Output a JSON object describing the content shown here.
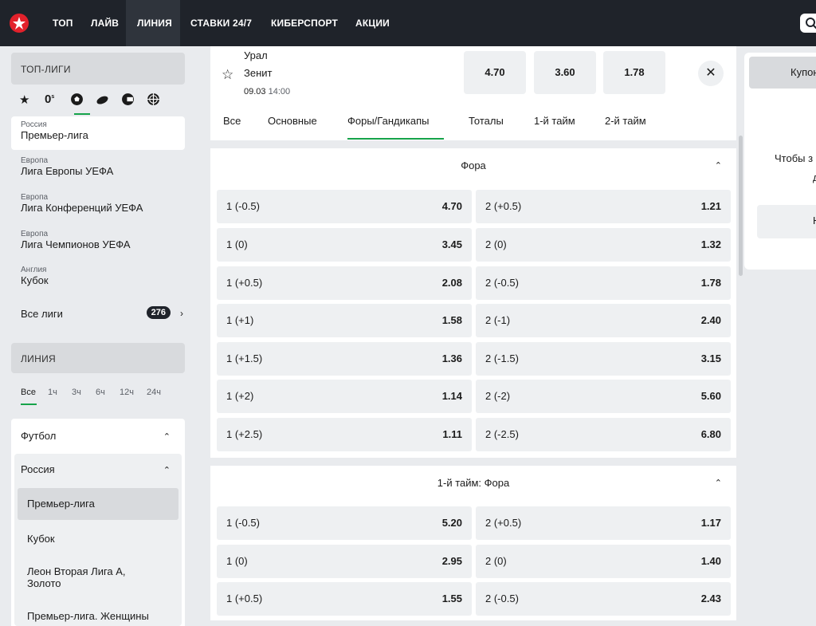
{
  "nav": {
    "items": [
      "ТОП",
      "ЛАЙВ",
      "ЛИНИЯ",
      "СТАВКИ 24/7",
      "КИБЕРСПОРТ",
      "АКЦИИ"
    ],
    "active": "ЛИНИЯ"
  },
  "sidebar": {
    "top_leagues_title": "ТОП-ЛИГИ",
    "sport_icons": [
      "star-icon",
      "zero-icon",
      "soccer-ball-icon",
      "hockey-puck-icon",
      "esports-icon",
      "basketball-icon"
    ],
    "zero_label": "0",
    "zero_sup": "s",
    "leagues": [
      {
        "country": "Россия",
        "name": "Премьер-лига"
      },
      {
        "country": "Европа",
        "name": "Лига Европы УЕФА"
      },
      {
        "country": "Европа",
        "name": "Лига Конференций УЕФА"
      },
      {
        "country": "Европа",
        "name": "Лига Чемпионов УЕФА"
      },
      {
        "country": "Англия",
        "name": "Кубок"
      }
    ],
    "all_leagues_label": "Все лиги",
    "all_leagues_count": "276",
    "line_title": "ЛИНИЯ",
    "time_filters": [
      "Все",
      "1ч",
      "3ч",
      "6ч",
      "12ч",
      "24ч"
    ],
    "sport": "Футбол",
    "country": "Россия",
    "sub_leagues": [
      "Премьер-лига",
      "Кубок",
      "Леон Вторая Лига А, Золото",
      "Премьер-лига. Женщины"
    ]
  },
  "match": {
    "team1": "Урал",
    "team2": "Зенит",
    "date": "09.03",
    "time": "14:00",
    "odds": [
      "4.70",
      "3.60",
      "1.78"
    ],
    "close": "✕",
    "tabs": [
      "Все",
      "Основные",
      "Форы/Гандикапы",
      "Тоталы",
      "1-й тайм",
      "2-й тайм"
    ],
    "active_tab": "Форы/Гандикапы"
  },
  "markets": [
    {
      "title": "Фора",
      "rows": [
        {
          "l1": "1 (-0.5)",
          "v1": "4.70",
          "l2": "2 (+0.5)",
          "v2": "1.21"
        },
        {
          "l1": "1 (0)",
          "v1": "3.45",
          "l2": "2 (0)",
          "v2": "1.32"
        },
        {
          "l1": "1 (+0.5)",
          "v1": "2.08",
          "l2": "2 (-0.5)",
          "v2": "1.78"
        },
        {
          "l1": "1 (+1)",
          "v1": "1.58",
          "l2": "2 (-1)",
          "v2": "2.40"
        },
        {
          "l1": "1 (+1.5)",
          "v1": "1.36",
          "l2": "2 (-1.5)",
          "v2": "3.15"
        },
        {
          "l1": "1 (+2)",
          "v1": "1.14",
          "l2": "2 (-2)",
          "v2": "5.60"
        },
        {
          "l1": "1 (+2.5)",
          "v1": "1.11",
          "l2": "2 (-2.5)",
          "v2": "6.80"
        }
      ]
    },
    {
      "title": "1-й тайм: Фора",
      "rows": [
        {
          "l1": "1 (-0.5)",
          "v1": "5.20",
          "l2": "2 (+0.5)",
          "v2": "1.17"
        },
        {
          "l1": "1 (0)",
          "v1": "2.95",
          "l2": "2 (0)",
          "v2": "1.40"
        },
        {
          "l1": "1 (+0.5)",
          "v1": "1.55",
          "l2": "2 (-0.5)",
          "v2": "2.43"
        }
      ]
    }
  ],
  "coupon": {
    "tab_label": "Купон",
    "text1": "Чтобы з",
    "text2": "д",
    "button_label": "Н"
  },
  "colors": {
    "nav_bg": "#1f232a",
    "accent_green": "#16a34a",
    "brand_red": "#e2212b"
  }
}
